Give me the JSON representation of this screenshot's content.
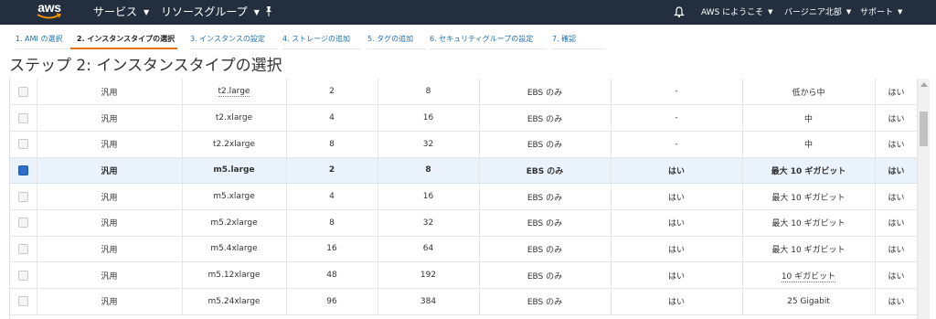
{
  "colors": {
    "nav_bg": "#232f3e",
    "accent": "#ec7211",
    "link": "#1f6fb2",
    "selected_row": "#eaf3fb",
    "checkbox_checked": "#2d6ec9"
  },
  "nav": {
    "logo": "aws",
    "services": "サービス",
    "resource_groups": "リソースグループ",
    "pin_icon": "pushpin-icon",
    "bell_icon": "bell-icon",
    "account": "AWS にようこそ",
    "region": "バージニア北部",
    "support": "サポート"
  },
  "tabs": [
    {
      "label": "1. AMI の選択",
      "active": false
    },
    {
      "label": "2. インスタンスタイプの選択",
      "active": true
    },
    {
      "label": "3. インスタンスの設定",
      "active": false
    },
    {
      "label": "4. ストレージの追加",
      "active": false
    },
    {
      "label": "5. タグの追加",
      "active": false
    },
    {
      "label": "6. セキュリティグループの設定",
      "active": false
    },
    {
      "label": "7. 確認",
      "active": false
    }
  ],
  "page_title": "ステップ 2: インスタンスタイプの選択",
  "rows": [
    {
      "family": "汎用",
      "type": "t2.large",
      "vcpu": "2",
      "memory": "8",
      "storage": "EBS のみ",
      "ebs_optimized": "-",
      "network": "低から中",
      "ipv6": "はい",
      "selected": false
    },
    {
      "family": "汎用",
      "type": "t2.xlarge",
      "vcpu": "4",
      "memory": "16",
      "storage": "EBS のみ",
      "ebs_optimized": "-",
      "network": "中",
      "ipv6": "はい",
      "selected": false
    },
    {
      "family": "汎用",
      "type": "t2.2xlarge",
      "vcpu": "8",
      "memory": "32",
      "storage": "EBS のみ",
      "ebs_optimized": "-",
      "network": "中",
      "ipv6": "はい",
      "selected": false
    },
    {
      "family": "汎用",
      "type": "m5.large",
      "vcpu": "2",
      "memory": "8",
      "storage": "EBS のみ",
      "ebs_optimized": "はい",
      "network": "最大 10 ギガビット",
      "ipv6": "はい",
      "selected": true
    },
    {
      "family": "汎用",
      "type": "m5.xlarge",
      "vcpu": "4",
      "memory": "16",
      "storage": "EBS のみ",
      "ebs_optimized": "はい",
      "network": "最大 10 ギガビット",
      "ipv6": "はい",
      "selected": false
    },
    {
      "family": "汎用",
      "type": "m5.2xlarge",
      "vcpu": "8",
      "memory": "32",
      "storage": "EBS のみ",
      "ebs_optimized": "はい",
      "network": "最大 10 ギガビット",
      "ipv6": "はい",
      "selected": false
    },
    {
      "family": "汎用",
      "type": "m5.4xlarge",
      "vcpu": "16",
      "memory": "64",
      "storage": "EBS のみ",
      "ebs_optimized": "はい",
      "network": "最大 10 ギガビット",
      "ipv6": "はい",
      "selected": false
    },
    {
      "family": "汎用",
      "type": "m5.12xlarge",
      "vcpu": "48",
      "memory": "192",
      "storage": "EBS のみ",
      "ebs_optimized": "はい",
      "network": "10 ギガビット",
      "ipv6": "はい",
      "selected": false
    },
    {
      "family": "汎用",
      "type": "m5.24xlarge",
      "vcpu": "96",
      "memory": "384",
      "storage": "EBS のみ",
      "ebs_optimized": "はい",
      "network": "25 Gigabit",
      "ipv6": "はい",
      "selected": false
    }
  ]
}
